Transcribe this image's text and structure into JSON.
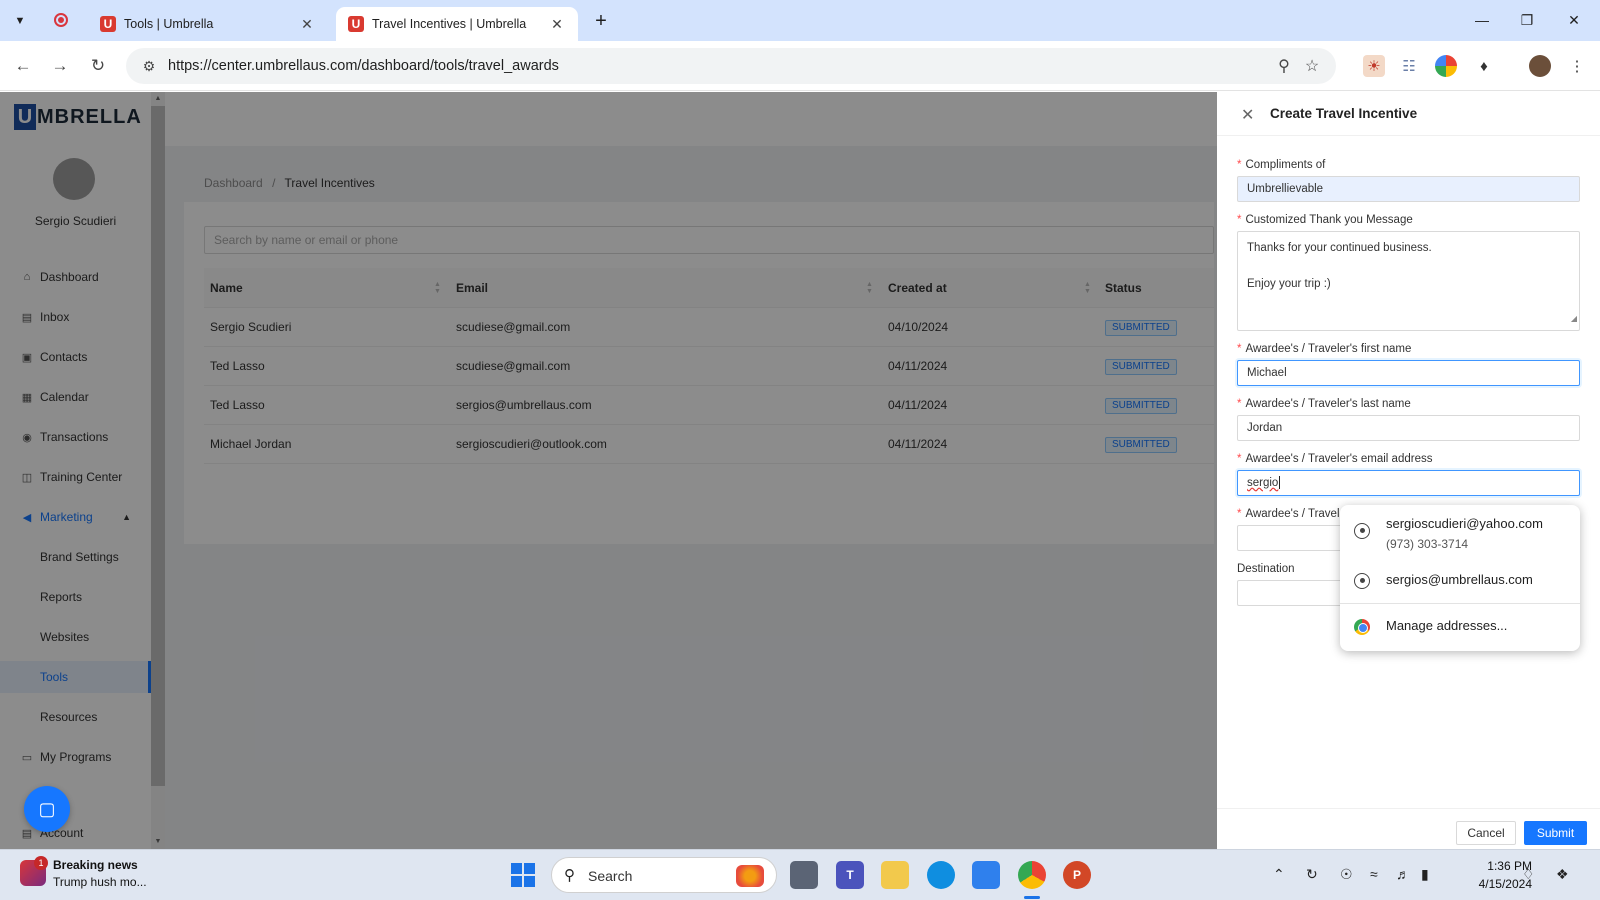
{
  "browser": {
    "tabs": [
      {
        "title": "Tools | Umbrella",
        "active": false
      },
      {
        "title": "Travel Incentives | Umbrella",
        "active": true
      }
    ],
    "url": "https://center.umbrellaus.com/dashboard/tools/travel_awards"
  },
  "sidebar": {
    "logo_letter": "U",
    "logo_text": "MBRELLA",
    "user_name": "Sergio Scudieri",
    "items": [
      {
        "label": "Dashboard",
        "icon": "home-icon"
      },
      {
        "label": "Inbox",
        "icon": "inbox-icon"
      },
      {
        "label": "Contacts",
        "icon": "contacts-icon"
      },
      {
        "label": "Calendar",
        "icon": "calendar-icon"
      },
      {
        "label": "Transactions",
        "icon": "transactions-icon"
      },
      {
        "label": "Training Center",
        "icon": "training-icon"
      },
      {
        "label": "Marketing",
        "icon": "megaphone-icon"
      },
      {
        "label": "Brand Settings"
      },
      {
        "label": "Reports"
      },
      {
        "label": "Websites"
      },
      {
        "label": "Tools"
      },
      {
        "label": "Resources"
      },
      {
        "label": "My Programs",
        "icon": "programs-icon"
      },
      {
        "label": "Account",
        "icon": "account-icon"
      }
    ],
    "active_item": "Tools"
  },
  "breadcrumb": {
    "root": "Dashboard",
    "separator": "/",
    "current": "Travel Incentives"
  },
  "search": {
    "placeholder": "Search by name or email or phone"
  },
  "table": {
    "columns": [
      "Name",
      "Email",
      "Created at",
      "Status"
    ],
    "rows": [
      {
        "name": "Sergio Scudieri",
        "email": "scudiese@gmail.com",
        "created": "04/10/2024",
        "status": "SUBMITTED"
      },
      {
        "name": "Ted Lasso",
        "email": "scudiese@gmail.com",
        "created": "04/11/2024",
        "status": "SUBMITTED"
      },
      {
        "name": "Ted Lasso",
        "email": "sergios@umbrellaus.com",
        "created": "04/11/2024",
        "status": "SUBMITTED"
      },
      {
        "name": "Michael Jordan",
        "email": "sergioscudieri@outlook.com",
        "created": "04/11/2024",
        "status": "SUBMITTED"
      }
    ]
  },
  "drawer": {
    "title": "Create Travel Incentive",
    "fields": {
      "compliments_label": "Compliments of",
      "compliments_value": "Umbrellievable",
      "message_label": "Customized Thank you Message",
      "message_value": "Thanks for your continued business.\n\nEnjoy your trip :)",
      "first_name_label": "Awardee's / Traveler's first name",
      "first_name_value": "Michael",
      "last_name_label": "Awardee's / Traveler's last name",
      "last_name_value": "Jordan",
      "email_label": "Awardee's / Traveler's email address",
      "email_value": "sergio",
      "phone_label": "Awardee's / Travel",
      "destination_label": "Destination"
    },
    "cancel_label": "Cancel",
    "submit_label": "Submit"
  },
  "autofill": {
    "suggestions": [
      {
        "email": "sergioscudieri@yahoo.com",
        "phone": "(973) 303-3714"
      },
      {
        "email": "sergios@umbrellaus.com"
      }
    ],
    "manage_label": "Manage addresses..."
  },
  "taskbar": {
    "news_title": "Breaking news",
    "news_subtitle": "Trump hush mo...",
    "news_badge": "1",
    "search_label": "Search",
    "time": "1:36 PM",
    "date": "4/15/2024"
  },
  "colors": {
    "primary": "#1677ff",
    "brand": "#1e4fa3",
    "tab_strip": "#d3e3fd",
    "favicon": "#d93a30"
  }
}
